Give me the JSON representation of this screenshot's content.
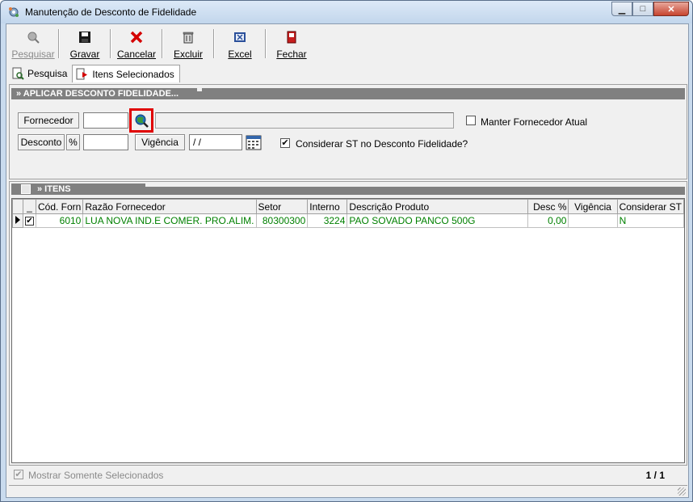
{
  "window": {
    "title": "Manutenção de Desconto de Fidelidade",
    "icon": "gear-icon",
    "controls": {
      "minimize": "▁",
      "maximize": "□",
      "close": "✕"
    }
  },
  "toolbar": [
    {
      "name": "pesquisar-button",
      "label": "Pesquisar",
      "icon": "search-globe-icon",
      "enabled": false
    },
    {
      "name": "gravar-button",
      "label": "Gravar",
      "icon": "floppy-icon",
      "enabled": true
    },
    {
      "name": "cancelar-button",
      "label": "Cancelar",
      "icon": "red-x-icon",
      "enabled": true
    },
    {
      "name": "excluir-button",
      "label": "Excluir",
      "icon": "trash-icon",
      "enabled": true
    },
    {
      "name": "excel-button",
      "label": "Excel",
      "icon": "excel-icon",
      "enabled": true
    },
    {
      "name": "fechar-button",
      "label": "Fechar",
      "icon": "door-icon",
      "enabled": true
    }
  ],
  "tabs": [
    {
      "label": "Pesquisa",
      "icon": "search-doc-icon",
      "active": false
    },
    {
      "label": "Itens Selecionados",
      "icon": "arrow-doc-icon",
      "active": true
    }
  ],
  "apply_section": {
    "title": "» APLICAR DESCONTO FIDELIDADE...",
    "fornecedor_label": "Fornecedor",
    "fornecedor_code": "",
    "fornecedor_name": "",
    "manter_label": "Manter Fornecedor Atual",
    "manter_checked": false,
    "desconto_label": "Desconto",
    "percent_label": "%",
    "desconto_value": "",
    "vigencia_label": "Vigência",
    "vigencia_value": " / /",
    "considerar_label": "Considerar ST no Desconto Fidelidade?",
    "considerar_checked": true
  },
  "items_section": {
    "title": "» ITENS",
    "columns": [
      "_",
      "Cód. Forn",
      "Razão Fornecedor",
      "Setor",
      "Interno",
      "Descrição Produto",
      "Desc %",
      "Vigência",
      "Considerar ST"
    ],
    "rows": [
      {
        "selected": true,
        "cod_forn": "6010",
        "razao": "LUA NOVA IND.E COMER. PRO.ALIM.",
        "setor": "80300300",
        "interno": "3224",
        "descricao": "PAO SOVADO PANCO 500G",
        "desc_pct": "0,00",
        "vigencia": "",
        "considerar_st": "N"
      }
    ]
  },
  "footer": {
    "mostrar_label": "Mostrar Somente Selecionados",
    "mostrar_checked": true,
    "page": "1 / 1"
  },
  "colors": {
    "title_bar": "#c9dbee",
    "section_header": "#808080",
    "row_text": "#008000",
    "highlight": "#e00000"
  }
}
